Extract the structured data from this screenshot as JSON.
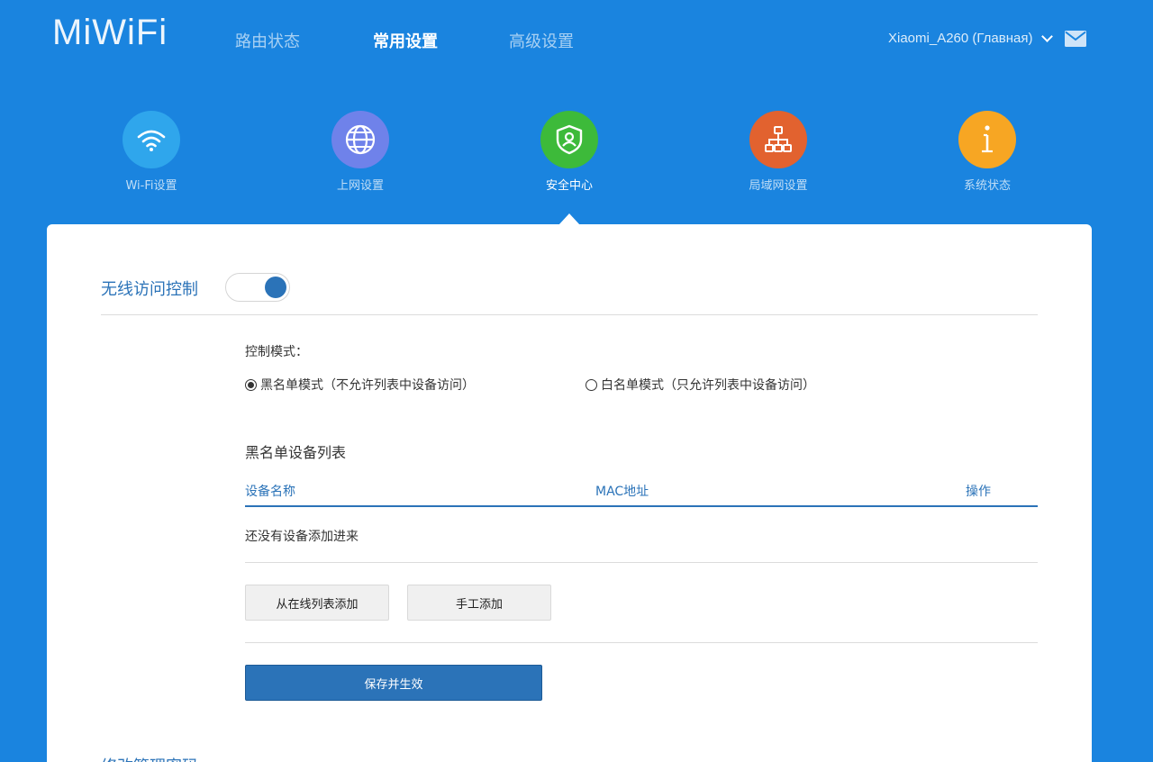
{
  "logo": {
    "text": "MiWiFi"
  },
  "nav": {
    "items": [
      {
        "label": "路由状态"
      },
      {
        "label": "常用设置"
      },
      {
        "label": "高级设置"
      }
    ]
  },
  "router": {
    "name": "Xiaomi_A260 (Главная)"
  },
  "tiles": [
    {
      "label": "Wi-Fi设置",
      "color": "#2fa6ec",
      "icon": "wifi-icon"
    },
    {
      "label": "上网设置",
      "color": "#6f82ea",
      "icon": "globe-icon"
    },
    {
      "label": "安全中心",
      "color": "#3dba3a",
      "icon": "shield-icon"
    },
    {
      "label": "局域网设置",
      "color": "#e2622f",
      "icon": "network-icon"
    },
    {
      "label": "系统状态",
      "color": "#f7a623",
      "icon": "info-icon"
    }
  ],
  "access_control": {
    "title": "无线访问控制",
    "enabled": true,
    "mode_label": "控制模式：",
    "modes": [
      {
        "label": "黑名单模式（不允许列表中设备访问）",
        "selected": true
      },
      {
        "label": "白名单模式（只允许列表中设备访问）",
        "selected": false
      }
    ],
    "list_title": "黑名单设备列表",
    "columns": [
      "设备名称",
      "MAC地址",
      "操作"
    ],
    "empty_text": "还没有设备添加进来",
    "add_online_label": "从在线列表添加",
    "add_manual_label": "手工添加",
    "save_label": "保存并生效"
  },
  "next_section": {
    "title": "修改管理密码"
  },
  "colors": {
    "header_bg": "#1a84df",
    "accent": "#2b73b8"
  }
}
